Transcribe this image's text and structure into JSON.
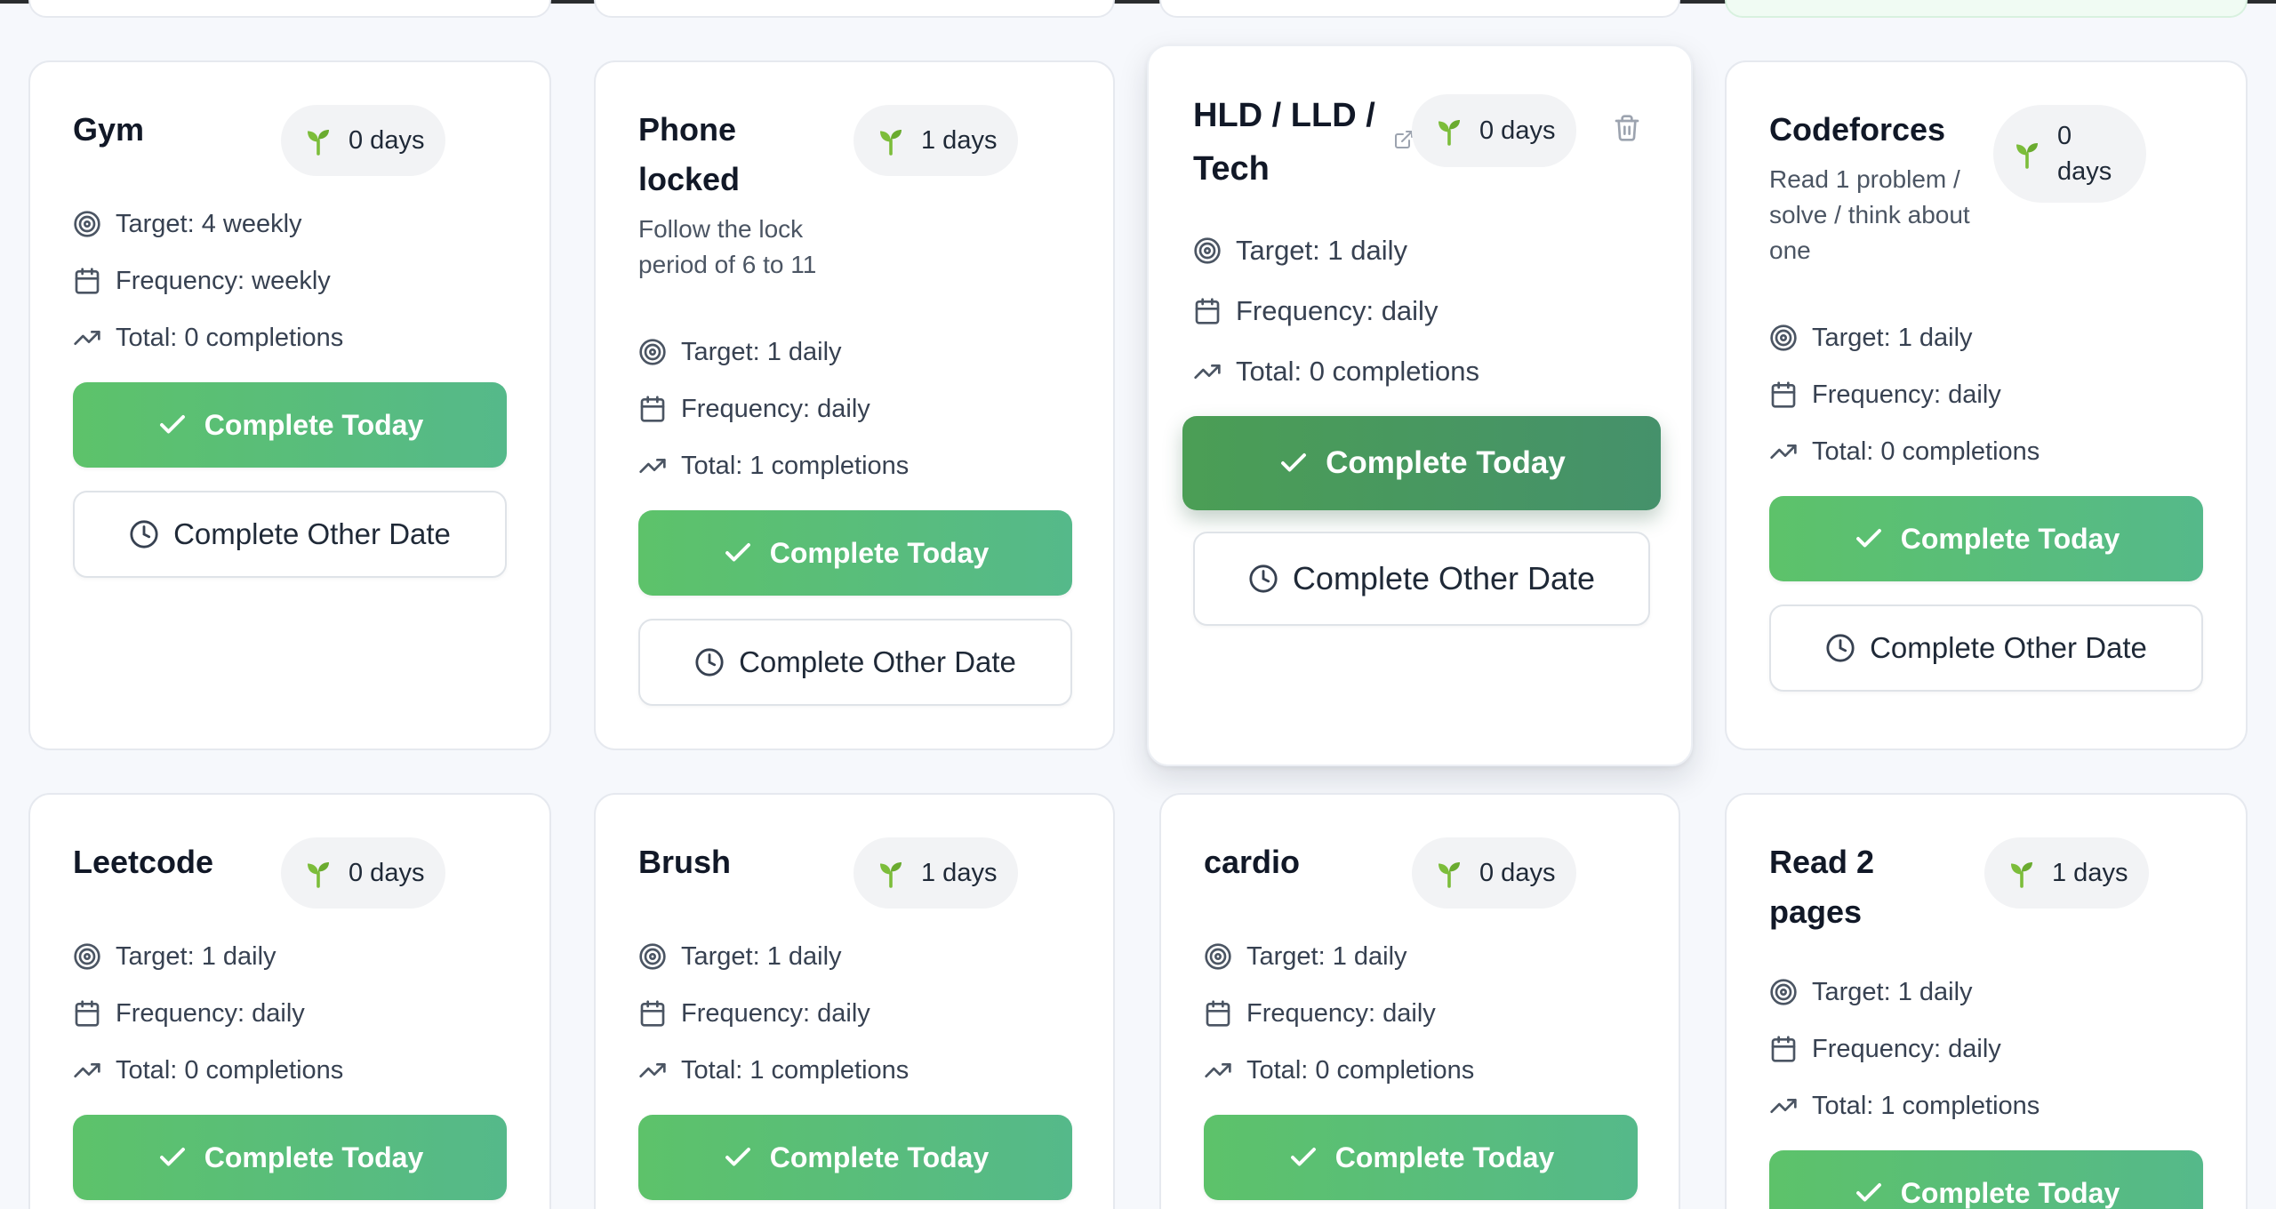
{
  "labels": {
    "complete_today": "Complete Today",
    "complete_other_date": "Complete Other Date"
  },
  "habits": [
    {
      "title": "Gym",
      "description": "",
      "streak": "0 days",
      "target": "Target: 4 weekly",
      "frequency": "Frequency: weekly",
      "total": "Total: 0 completions"
    },
    {
      "title": "Phone locked",
      "description": "Follow the lock period of 6 to 11",
      "streak": "1 days",
      "target": "Target: 1 daily",
      "frequency": "Frequency: daily",
      "total": "Total: 1 completions"
    },
    {
      "title": "HLD / LLD / Tech",
      "description": "",
      "streak": "0 days",
      "target": "Target: 1 daily",
      "frequency": "Frequency: daily",
      "total": "Total: 0 completions"
    },
    {
      "title": "Codeforces",
      "description": "Read 1 problem / solve / think about one",
      "streak": "0 days",
      "target": "Target: 1 daily",
      "frequency": "Frequency: daily",
      "total": "Total: 0 completions"
    },
    {
      "title": "Leetcode",
      "description": "",
      "streak": "0 days",
      "target": "Target: 1 daily",
      "frequency": "Frequency: daily",
      "total": "Total: 0 completions"
    },
    {
      "title": "Brush",
      "description": "",
      "streak": "1 days",
      "target": "Target: 1 daily",
      "frequency": "Frequency: daily",
      "total": "Total: 1 completions"
    },
    {
      "title": "cardio",
      "description": "",
      "streak": "0 days",
      "target": "Target: 1 daily",
      "frequency": "Frequency: daily",
      "total": "Total: 0 completions"
    },
    {
      "title": "Read 2 pages",
      "description": "",
      "streak": "1 days",
      "target": "Target: 1 daily",
      "frequency": "Frequency: daily",
      "total": "Total: 1 completions"
    }
  ],
  "colors": {
    "accent_green": "#5dc26a",
    "accent_teal": "#55b98a",
    "page_background": "#f6f8fc"
  },
  "icons": {
    "streak": "sprout-icon",
    "target": "target-icon",
    "frequency": "calendar-icon",
    "total": "trending-up-icon",
    "complete_today": "check-icon",
    "complete_other_date": "clock-icon",
    "external": "external-link-icon",
    "delete": "trash-icon"
  }
}
